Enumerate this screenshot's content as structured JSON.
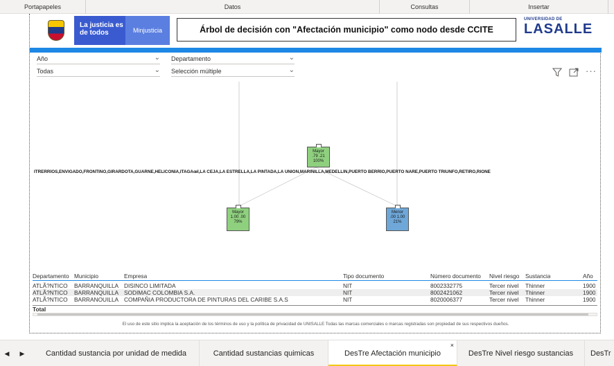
{
  "ribbon": {
    "groups": [
      {
        "label": "Portapapeles"
      },
      {
        "label": "Datos"
      },
      {
        "label": "Consultas"
      },
      {
        "label": "Insertar"
      }
    ]
  },
  "header": {
    "logo_justicia": "La justicia es de todos",
    "logo_minjusticia": "Minjusticia",
    "title": "Árbol de decisión con \"Afectación  municipio\" como nodo desde CCITE",
    "lasalle_small": "UNIVERSIDAD DE",
    "lasalle_big": "LASALLE"
  },
  "slicers": {
    "year": {
      "label": "Año",
      "value": "Todas"
    },
    "department": {
      "label": "Departamento",
      "value": "Selección múltiple"
    }
  },
  "tree": {
    "municipios_text": "ITRERRÍOS,ENVIGADO,FRONTINO,GIRARDOTA,GUARNE,HELICONIA,ITAGÃœÍ,LA CEJA,LA ESTRELLA,LA PINTADA,LA UNIÓN,MARINILLA,MEDELLÍN,PUERTO BERRÍO,PUERTO NARE,PUERTO TRIUNFO,RETIRO,RIONE",
    "root": {
      "label": "Mayor",
      "values": ".79 .21",
      "pct": "100%",
      "color": "#8fd07f"
    },
    "left": {
      "label": "Mayor",
      "values": "1.00 .00",
      "pct": "79%",
      "color": "#8fd07f"
    },
    "right": {
      "label": "Menor",
      "values": ".00 1.00",
      "pct": "21%",
      "color": "#6ea7d8"
    }
  },
  "table": {
    "columns": [
      "Departamento",
      "Municipio",
      "Empresa",
      "Tipo documento",
      "Número documento",
      "Nivel riesgo",
      "Sustancia",
      "Año"
    ],
    "rows": [
      [
        "ATLÃ?NTICO",
        "BARRANQUILLA",
        "DISINCO LIMITADA",
        "NIT",
        "8002332775",
        "Tercer nivel",
        "Thinner",
        "1900"
      ],
      [
        "ATLÃ?NTICO",
        "BARRANQUILLA",
        "SODIMAC COLOMBIA S.A.",
        "NIT",
        "8002421062",
        "Tercer nivel",
        "Thinner",
        "1900"
      ],
      [
        "ATLÃ?NTICO",
        "BARRANQUILLA",
        "COMPAÑIA PRODUCTORA DE PINTURAS DEL CARIBE S.A.S",
        "NIT",
        "8020006377",
        "Tercer nivel",
        "Thinner",
        "1900"
      ]
    ],
    "total_label": "Total"
  },
  "disclaimer": "El uso de este sitio implica la aceptación de los términos de uso y la política de privacidad de UNISALLE Todas las marcas comerciales o marcas registradas son propiedad de sus respectivos dueños.",
  "tabs": [
    {
      "label": "Cantidad sustancia por unidad de medida",
      "active": false
    },
    {
      "label": "Cantidad sustancias quimicas",
      "active": false
    },
    {
      "label": "DesTre Afectación municipio",
      "active": true
    },
    {
      "label": "DesTre Nivel riesgo sustancias",
      "active": false
    },
    {
      "label": "DesTr",
      "active": false
    }
  ],
  "colors": {
    "accent_bar": "#1e88e5",
    "active_tab": "#f2c811",
    "brand_blue": "#1f3b8c"
  }
}
